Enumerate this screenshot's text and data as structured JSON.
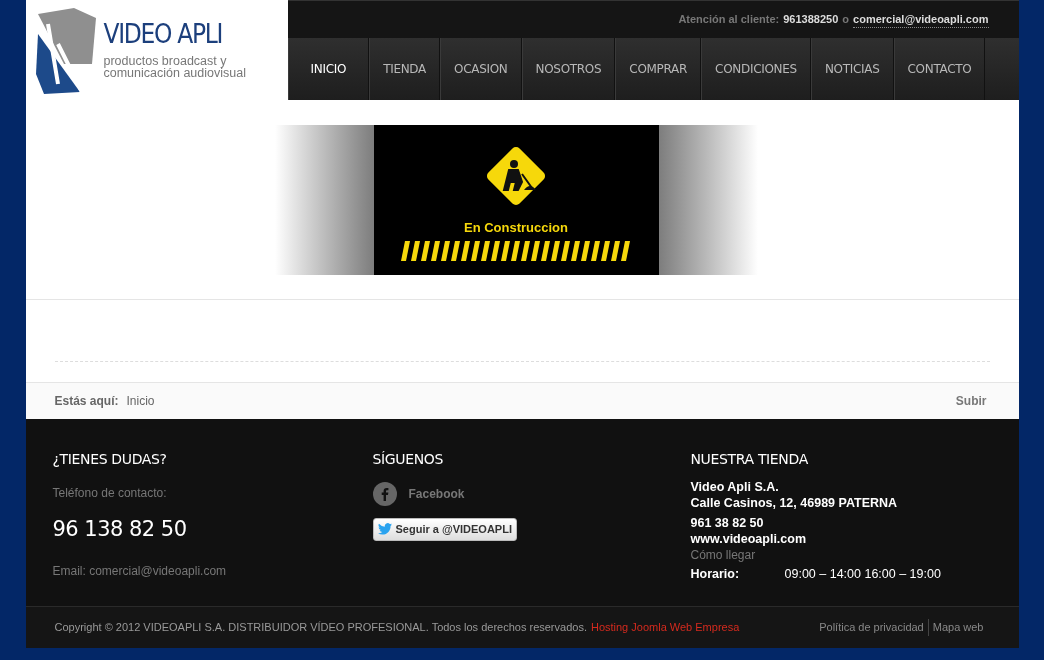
{
  "logo": {
    "name": "VIDEO APLI",
    "tagline_1": "productos broadcast y",
    "tagline_2": "comunicación audiovisual"
  },
  "top_bar": {
    "label": "Atención al cliente:",
    "phone": "961388250",
    "separator": "o",
    "email": "comercial@videoapli.com"
  },
  "nav": [
    {
      "label": "INICIO",
      "selected": true
    },
    {
      "label": "TIENDA",
      "selected": false
    },
    {
      "label": "OCASION",
      "selected": false
    },
    {
      "label": "NOSOTROS",
      "selected": false
    },
    {
      "label": "COMPRAR",
      "selected": false
    },
    {
      "label": "CONDICIONES",
      "selected": false
    },
    {
      "label": "NOTICIAS",
      "selected": false
    },
    {
      "label": "CONTACTO",
      "selected": false
    }
  ],
  "banner": {
    "caption": "En Construccion"
  },
  "breadcrumb": {
    "label": "Estás aquí:",
    "current": "Inicio",
    "top_link": "Subir"
  },
  "footer": {
    "dudas": {
      "title": "¿TIENES DUDAS?",
      "phone_label": "Teléfono de contacto:",
      "phone": "96 138 82 50",
      "email": "Email: comercial@videoapli.com"
    },
    "siguenos": {
      "title": "SÍGUENOS",
      "facebook": "Facebook",
      "twitter": "Seguir a @VIDEOAPLI"
    },
    "tienda": {
      "title": "NUESTRA TIENDA",
      "name": "Video Apli S.A.",
      "address": "Calle Casinos, 12, 46989 PATERNA",
      "phone": "961 38 82 50",
      "web": "www.videoapli.com",
      "directions": "Cómo llegar",
      "hours_label": "Horario:",
      "hours": "09:00 – 14:00 16:00 – 19:00"
    }
  },
  "bottom": {
    "copyright": "Copyright © 2012 VIDEOAPLI S.A. DISTRIBUIDOR VÍDEO PROFESIONAL. Todos los derechos reservados.",
    "hosting": "Hosting Joomla Web Empresa",
    "links": [
      "Política de privacidad",
      "Mapa web"
    ]
  }
}
